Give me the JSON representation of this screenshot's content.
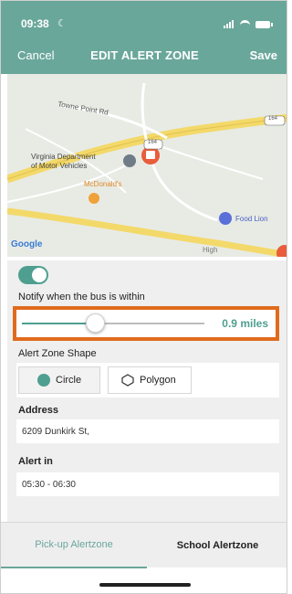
{
  "status_bar": {
    "time": "09:38"
  },
  "nav": {
    "cancel": "Cancel",
    "title": "EDIT ALERT ZONE",
    "save": "Save"
  },
  "map": {
    "labels": {
      "towne_point": "Towne Point Rd",
      "dmv": "Virginia Department\nof Motor Vehicles",
      "mcdonalds": "McDonald's",
      "food_lion": "Food Lion",
      "route_164a": "164",
      "route_164b": "164",
      "google": "Google",
      "high": "High"
    }
  },
  "settings": {
    "toggle_on": true,
    "notify_label": "Notify when the bus is within",
    "distance": {
      "value_text": "0.9 miles",
      "fraction": 0.4
    },
    "shape_label": "Alert Zone Shape",
    "shape_options": {
      "circle": "Circle",
      "polygon": "Polygon"
    },
    "selected_shape": "circle",
    "address_label": "Address",
    "address_value": "6209 Dunkirk St,",
    "alert_in_label": "Alert in",
    "alert_in_value": "05:30 - 06:30"
  },
  "tabs": {
    "pickup": "Pick-up Alertzone",
    "school": "School Alertzone",
    "active": "pickup"
  },
  "colors": {
    "brand": "#6aa79b",
    "accent": "#4e9f8f",
    "highlight": "#e06b1d"
  }
}
